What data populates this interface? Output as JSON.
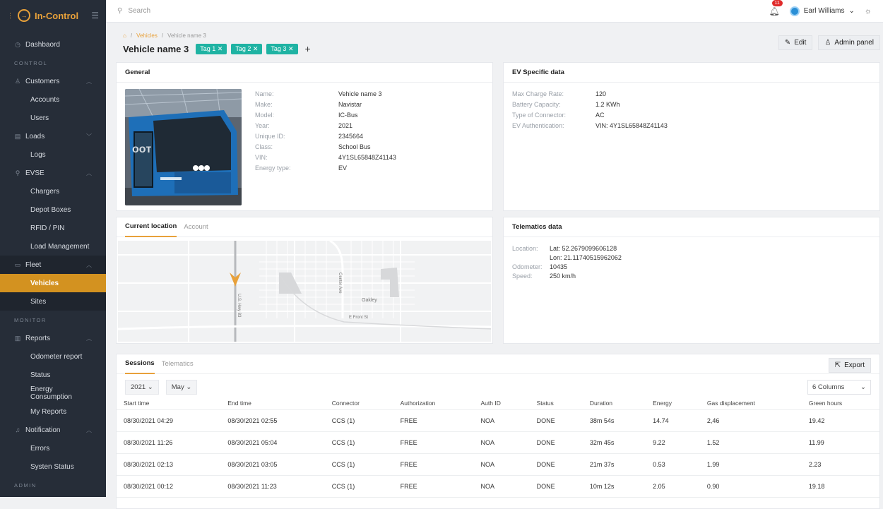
{
  "app": {
    "name": "In-Control"
  },
  "sidebar": {
    "dashboard": "Dashbaord",
    "section_control": "CONTROL",
    "customers": "Customers",
    "accounts": "Accounts",
    "users": "Users",
    "loads": "Loads",
    "logs": "Logs",
    "evse": "EVSE",
    "chargers": "Chargers",
    "depot_boxes": "Depot Boxes",
    "rfid": "RFID / PIN",
    "load_mgmt": "Load Management",
    "fleet": "Fleet",
    "vehicles": "Vehicles",
    "sites": "Sites",
    "section_monitor": "MONITOR",
    "reports": "Reports",
    "odometer_report": "Odometer report",
    "status": "Status",
    "energy_consumption": "Energy Consumption",
    "my_reports": "My Reports",
    "notification": "Notification",
    "errors": "Errors",
    "system_status": "Systen Status",
    "section_admin": "ADMIN"
  },
  "topbar": {
    "search_placeholder": "Search",
    "notif_count": "11",
    "user_name": "Earl Williams"
  },
  "breadcrumb": {
    "vehicles": "Vehicles",
    "current": "Vehicle name 3"
  },
  "page": {
    "title": "Vehicle name 3",
    "tags": [
      "Tag 1",
      "Tag 2",
      "Tag 3"
    ],
    "edit": "Edit",
    "admin_panel": "Admin panel"
  },
  "general": {
    "title": "General",
    "fields": [
      {
        "k": "Name:",
        "v": "Vehicle name 3"
      },
      {
        "k": "Make:",
        "v": "Navistar"
      },
      {
        "k": "Model:",
        "v": "IC-Bus"
      },
      {
        "k": "Year:",
        "v": "2021"
      },
      {
        "k": "Unique ID:",
        "v": "2345664"
      },
      {
        "k": "Class:",
        "v": "School Bus"
      },
      {
        "k": "VIN:",
        "v": "4Y1SL65848Z41143"
      },
      {
        "k": "Energy type:",
        "v": "EV"
      }
    ]
  },
  "ev": {
    "title": "EV Specific data",
    "fields": [
      {
        "k": "Max Charge Rate:",
        "v": "120"
      },
      {
        "k": "Battery Capacity:",
        "v": "1.2 KWh"
      },
      {
        "k": "Type of Connector:",
        "v": "AC"
      },
      {
        "k": "EV Authentication:",
        "v": "VIN: 4Y1SL65848Z41143"
      }
    ]
  },
  "location": {
    "tab_current": "Current location",
    "tab_account": "Account",
    "map_labels": [
      "Oakley",
      "E Front St",
      "Center Ave",
      "U.S. Hwy 83"
    ]
  },
  "telematics": {
    "title": "Telematics data",
    "location_label": "Location:",
    "lat": "Lat: 52.2679099606128",
    "lon": "Lon: 21.11740515962062",
    "odometer_label": "Odometer:",
    "odometer": "10435",
    "speed_label": "Speed:",
    "speed": "250 km/h"
  },
  "sessions": {
    "tab_sessions": "Sessions",
    "tab_telematics": "Telematics",
    "export": "Export",
    "year": "2021",
    "month": "May",
    "columns": "6 Columns",
    "headers": [
      "Start time",
      "End time",
      "Connector",
      "Authorization",
      "Auth ID",
      "Status",
      "Duration",
      "Energy",
      "Gas displacement",
      "Green hours"
    ],
    "rows": [
      [
        "08/30/2021 04:29",
        "08/30/2021 02:55",
        "CCS (1)",
        "FREE",
        "NOA",
        "DONE",
        "38m 54s",
        "14.74",
        "2,46",
        "19.42"
      ],
      [
        "08/30/2021 11:26",
        "08/30/2021 05:04",
        "CCS (1)",
        "FREE",
        "NOA",
        "DONE",
        "32m 45s",
        "9.22",
        "1.52",
        "11.99"
      ],
      [
        "08/30/2021 02:13",
        "08/30/2021 03:05",
        "CCS (1)",
        "FREE",
        "NOA",
        "DONE",
        "21m 37s",
        "0.53",
        "1.99",
        "2.23"
      ],
      [
        "08/30/2021 00:12",
        "08/30/2021 11:23",
        "CCS (1)",
        "FREE",
        "NOA",
        "DONE",
        "10m 12s",
        "2.05",
        "0.90",
        "19.18"
      ]
    ]
  }
}
